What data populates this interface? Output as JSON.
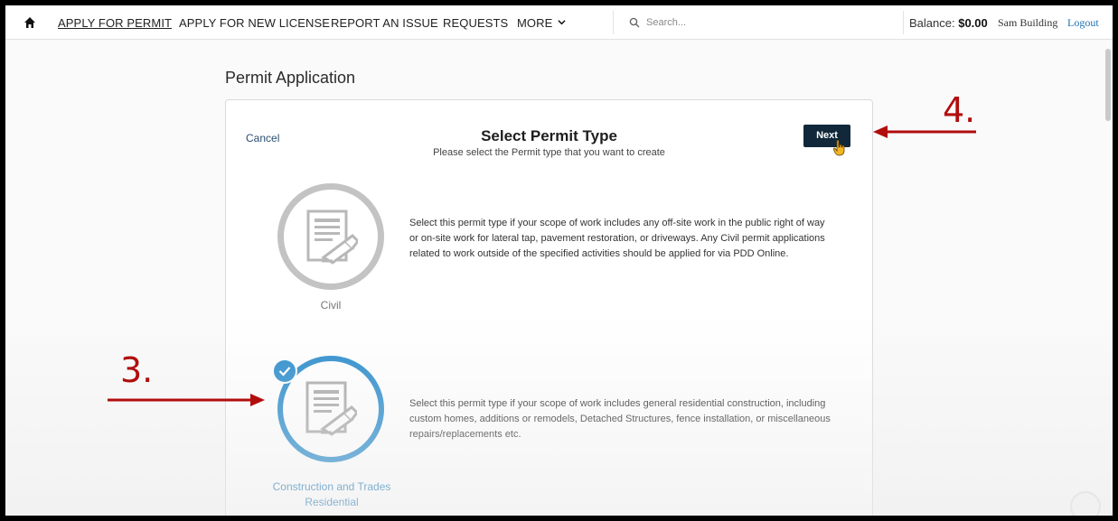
{
  "nav": {
    "items": [
      {
        "label": "APPLY FOR PERMIT",
        "active": true
      },
      {
        "label": "APPLY FOR NEW LICENSE"
      },
      {
        "label": "REPORT AN ISSUE"
      },
      {
        "label": "REQUESTS"
      },
      {
        "label": "MORE"
      }
    ],
    "search_placeholder": "Search...",
    "balance_label": "Balance:",
    "balance_value": "$0.00",
    "user_name": "Sam Building",
    "logout_label": "Logout"
  },
  "page": {
    "title": "Permit Application"
  },
  "card": {
    "cancel_label": "Cancel",
    "title": "Select Permit Type",
    "subtitle": "Please select the Permit type that you want to create",
    "next_label": "Next",
    "options": [
      {
        "label": "Civil",
        "selected": false,
        "description": "Select this permit type if your scope of work includes any off-site work in the public right of way or on-site work for lateral tap, pavement restoration, or driveways. Any Civil permit applications related to work outside of the specified activities should be applied for via PDD Online."
      },
      {
        "label_line1": "Construction and Trades",
        "label_line2": "Residential",
        "selected": true,
        "description": "Select this permit type if your scope of work includes general residential construction, including custom homes, additions or remodels, Detached Structures, fence installation, or miscellaneous repairs/replacements etc."
      }
    ]
  },
  "annotations": {
    "step3": "3.",
    "step4": "4."
  },
  "colors": {
    "accent": "#2a8ccc",
    "next_button": "#10283a",
    "annotation": "#b10d0d"
  }
}
